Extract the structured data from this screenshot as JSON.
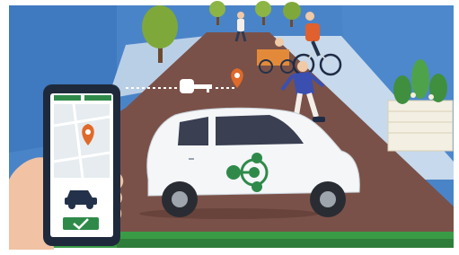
{
  "illustration": {
    "theme": "car-sharing",
    "elements": [
      "street-scene",
      "smartphone-app",
      "white-city-car",
      "share-network-icon",
      "car-key",
      "map-pin",
      "cyclist",
      "cargo-bike",
      "inline-skater",
      "pedestrian",
      "trees",
      "planter-box"
    ]
  },
  "phone": {
    "screen_icons": [
      "map-pin-icon",
      "car-icon",
      "checkmark-icon"
    ]
  },
  "colors": {
    "sky": "#4a84c8",
    "road": "#7a5148",
    "sidewalk": "#b9cfe6",
    "brand_green": "#2f8a4a",
    "pin_orange": "#e06a2a",
    "car_body": "#f4f6f8"
  }
}
